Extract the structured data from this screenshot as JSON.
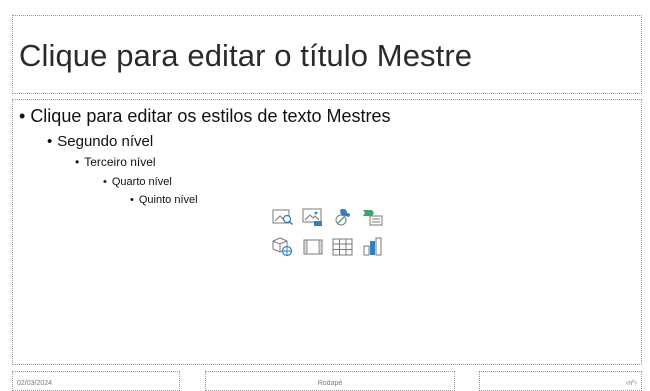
{
  "slide": {
    "title": "Clique para editar o título Mestre",
    "body": {
      "level1": "Clique para editar os estilos de texto Mestres",
      "level2": "Segundo nível",
      "level3": "Terceiro nível",
      "level4": "Quarto nível",
      "level5": "Quinto nível",
      "bullet_char": "•"
    },
    "insert_icons": [
      {
        "name": "stock-images-icon"
      },
      {
        "name": "pictures-icon"
      },
      {
        "name": "icons-icon"
      },
      {
        "name": "smartart-icon"
      },
      {
        "name": "3d-models-icon"
      },
      {
        "name": "video-icon"
      },
      {
        "name": "table-icon"
      },
      {
        "name": "chart-icon"
      }
    ],
    "footer": {
      "date": "02/03/2024",
      "center": "Rodapé",
      "number": "‹nº›"
    }
  },
  "colors": {
    "icon_blue": "#2f7fc1",
    "icon_green": "#3fa36b",
    "icon_gray": "#7a7a7a",
    "border": "#9a9a9a"
  }
}
